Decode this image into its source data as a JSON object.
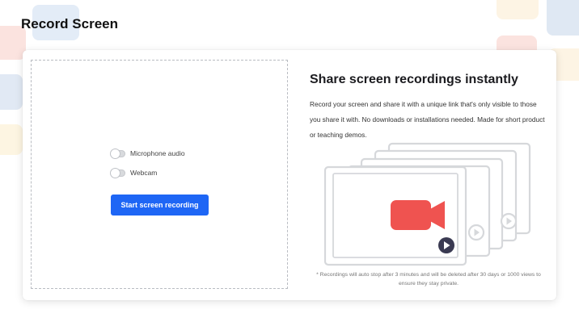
{
  "page": {
    "title": "Record Screen"
  },
  "recorder": {
    "toggles": [
      {
        "label": "Microphone audio",
        "enabled": false
      },
      {
        "label": "Webcam",
        "enabled": false
      }
    ],
    "start_label": "Start screen recording",
    "accent_color": "#1e66f5"
  },
  "info": {
    "heading": "Share screen recordings instantly",
    "description": "Record your screen and share it with a unique link that's only visible to those you share it with. No downloads or installations needed. Made for short product or teaching demos.",
    "footnote": "* Recordings will auto stop after 3 minutes and will be deleted after 30 days or 1000 views to ensure they stay private.",
    "illustration": {
      "icons": [
        "camera-icon",
        "play-icon"
      ],
      "camera_color": "#ef5350"
    }
  }
}
